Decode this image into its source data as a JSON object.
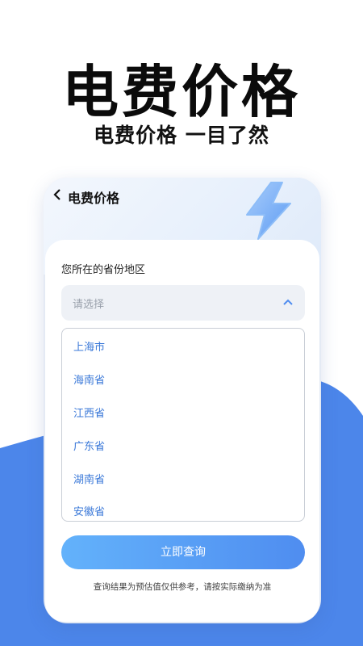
{
  "hero": {
    "title": "电费价格",
    "subtitle": "电费价格 一目了然"
  },
  "header": {
    "back_icon": "chevron-left-icon",
    "title": "电费价格"
  },
  "form": {
    "region_label": "您所在的省份地区",
    "select_placeholder": "请选择",
    "options": [
      "上海市",
      "海南省",
      "江西省",
      "广东省",
      "湖南省",
      "安徽省"
    ],
    "submit_label": "立即查询",
    "disclaimer": "查询结果为预估值仅供参考，请按实际缴纳为准"
  },
  "colors": {
    "accent_blue": "#4f8df0",
    "button_start": "#63b2fb",
    "option_text": "#3a78d8",
    "background_wave": "#4c86ea"
  }
}
